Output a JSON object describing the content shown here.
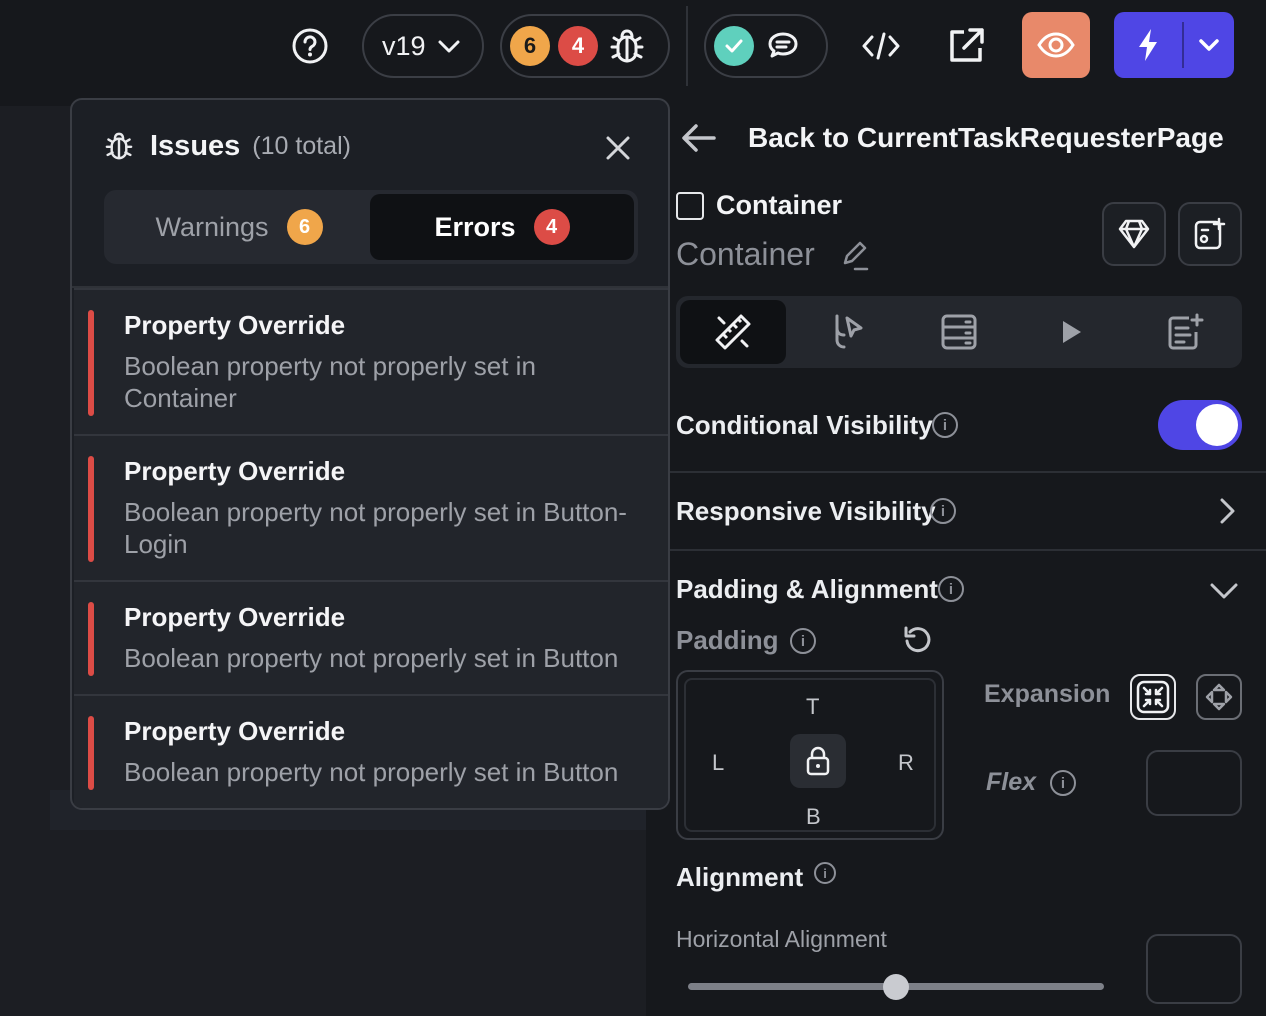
{
  "topbar": {
    "version_label": "v19",
    "warnings_count": "6",
    "errors_count": "4"
  },
  "issues": {
    "title": "Issues",
    "total": "(10 total)",
    "tabs": {
      "warnings_label": "Warnings",
      "warnings_count": "6",
      "errors_label": "Errors",
      "errors_count": "4"
    },
    "items": [
      {
        "title": "Property Override",
        "desc": "Boolean property not properly set in Container"
      },
      {
        "title": "Property Override",
        "desc": "Boolean property not properly set in Button-Login"
      },
      {
        "title": "Property Override",
        "desc": "Boolean property not properly set in Button"
      },
      {
        "title": "Property Override",
        "desc": "Boolean property not properly set in Button"
      }
    ]
  },
  "panel": {
    "back_label": "Back to CurrentTaskRequesterPage",
    "widget_type": "Container",
    "widget_name": "Container",
    "conditional_visibility": "Conditional Visibility",
    "conditional_visibility_on": true,
    "responsive_visibility": "Responsive Visibility",
    "padding_alignment": "Padding & Alignment",
    "padding": "Padding",
    "pad_top": "T",
    "pad_left": "L",
    "pad_right": "R",
    "pad_bottom": "B",
    "expansion": "Expansion",
    "flex": "Flex",
    "alignment": "Alignment",
    "horizontal_alignment": "Horizontal Alignment",
    "horizontal_alignment_value": 0.5
  },
  "colors": {
    "accent": "#4f46e5",
    "error": "#dc4c46",
    "warning": "#f0a64a",
    "preview": "#e8896a",
    "success": "#5fd0bd"
  }
}
